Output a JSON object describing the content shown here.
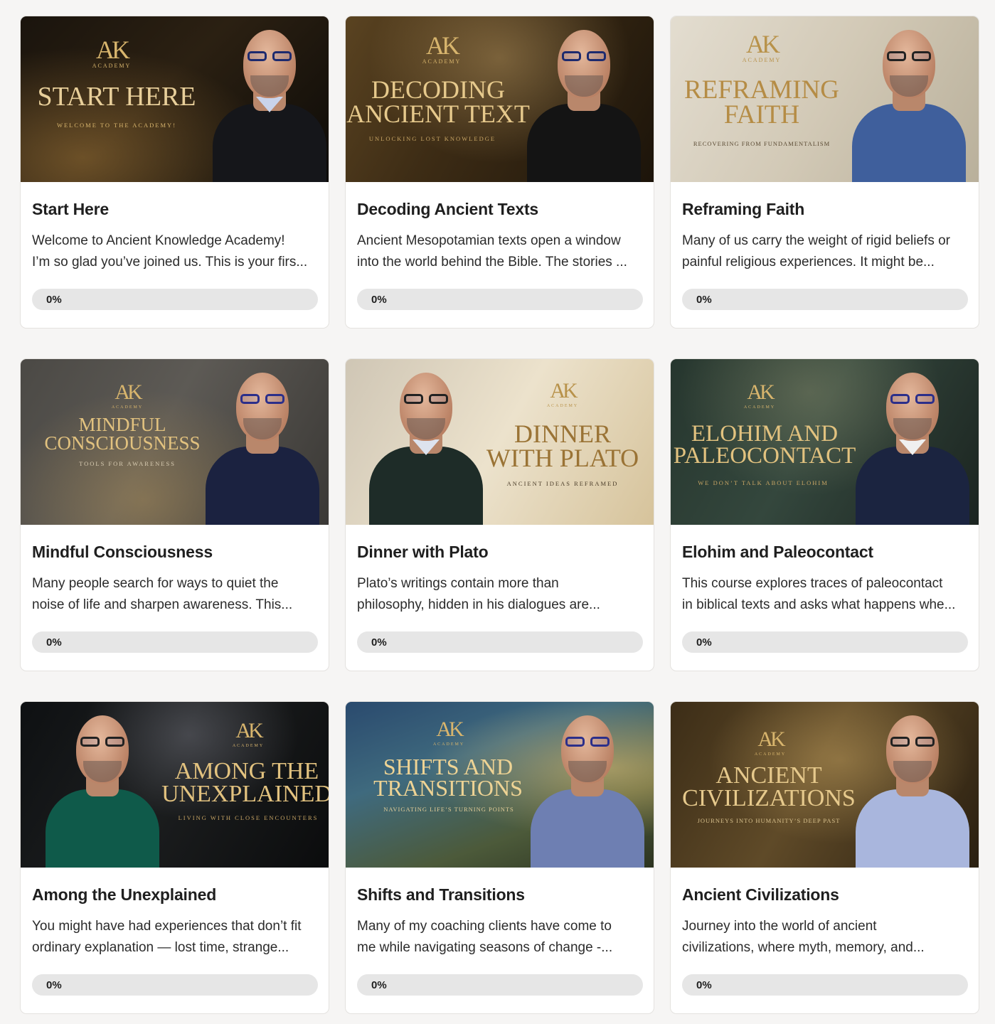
{
  "logo_text": "AK",
  "logo_sub": "ACADEMY",
  "colors": {
    "page_bg": "#f6f5f4",
    "card_bg": "#ffffff",
    "progress_track": "#e6e6e6",
    "gold": "#d8b56d"
  },
  "courses": [
    {
      "title": "Start Here",
      "desc_line1": "Welcome to Ancient Knowledge Academy!",
      "desc_line2": "I’m so glad you’ve joined us. This is your firs...",
      "progress_label": "0%",
      "progress": 0,
      "thumb_heading": "START HERE",
      "thumb_tagline": "WELCOME TO THE ACADEMY!"
    },
    {
      "title": "Decoding Ancient Texts",
      "desc_line1": "Ancient Mesopotamian texts open a window",
      "desc_line2": "into the world behind the Bible. The stories ...",
      "progress_label": "0%",
      "progress": 0,
      "thumb_heading_1": "DECODING",
      "thumb_heading_2": "ANCIENT TEXT",
      "thumb_tagline": "UNLOCKING LOST KNOWLEDGE"
    },
    {
      "title": "Reframing Faith",
      "desc_line1": "Many of us carry the weight of rigid beliefs or",
      "desc_line2": "painful religious experiences. It might be...",
      "progress_label": "0%",
      "progress": 0,
      "thumb_heading_1": "REFRAMING",
      "thumb_heading_2": "FAITH",
      "thumb_tagline": "RECOVERING FROM FUNDAMENTALISM"
    },
    {
      "title": "Mindful Consciousness",
      "desc_line1": "Many people search for ways to quiet the",
      "desc_line2": "noise of life and sharpen awareness. This...",
      "progress_label": "0%",
      "progress": 0,
      "thumb_heading_1": "MINDFUL",
      "thumb_heading_2": "CONSCIOUSNESS",
      "thumb_tagline": "TOOLS FOR AWARENESS"
    },
    {
      "title": "Dinner with Plato",
      "desc_line1": "Plato’s writings contain more than",
      "desc_line2": "philosophy, hidden in his dialogues are...",
      "progress_label": "0%",
      "progress": 0,
      "thumb_heading_1": "DINNER",
      "thumb_heading_2": "WITH PLATO",
      "thumb_tagline": "ANCIENT IDEAS REFRAMED"
    },
    {
      "title": "Elohim and Paleocontact",
      "desc_line1": "This course explores traces of paleocontact",
      "desc_line2": "in biblical texts and asks what happens whe...",
      "progress_label": "0%",
      "progress": 0,
      "thumb_heading_1": "ELOHIM AND",
      "thumb_heading_2": "PALEOCONTACT",
      "thumb_tagline": "WE DON’T TALK ABOUT ELOHIM"
    },
    {
      "title": "Among the Unexplained",
      "desc_line1": "You might have had experiences that don’t fit",
      "desc_line2": "ordinary explanation — lost time, strange...",
      "progress_label": "0%",
      "progress": 0,
      "thumb_heading_1": "AMONG THE",
      "thumb_heading_2": "UNEXPLAINED",
      "thumb_tagline": "LIVING WITH CLOSE ENCOUNTERS"
    },
    {
      "title": "Shifts and Transitions",
      "desc_line1": "Many of my coaching clients have come to",
      "desc_line2": "me while navigating seasons of change -...",
      "progress_label": "0%",
      "progress": 0,
      "thumb_heading_1": "SHIFTS AND",
      "thumb_heading_2": "TRANSITIONS",
      "thumb_tagline": "NAVIGATING LIFE’S TURNING POINTS"
    },
    {
      "title": "Ancient Civilizations",
      "desc_line1": "Journey into the world of ancient",
      "desc_line2": "civilizations, where myth, memory, and...",
      "progress_label": "0%",
      "progress": 0,
      "thumb_heading_1": "ANCIENT",
      "thumb_heading_2": "CIVILIZATIONS",
      "thumb_tagline": "JOURNEYS INTO HUMANITY’S DEEP PAST"
    }
  ]
}
